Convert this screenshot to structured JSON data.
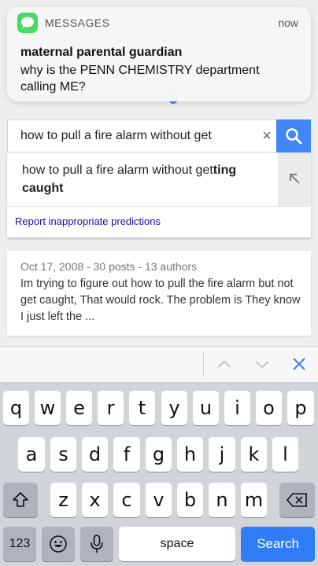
{
  "notification": {
    "app": "MESSAGES",
    "time": "now",
    "title": "maternal parental guardian",
    "body": "why is the PENN CHEMISTRY department calling ME?"
  },
  "search": {
    "query": "how to pull a fire alarm without get",
    "clear_label": "×"
  },
  "suggestions": [
    {
      "prefix": "how to pull a fire alarm without get",
      "completion": "ting caught"
    }
  ],
  "report_link": "Report inappropriate predictions",
  "result": {
    "meta": "Oct 17, 2008 - 30 posts - 13 authors",
    "snippet": "Im trying to figure out how to pull the fire alarm but not get caught, That would rock. The problem is They know I just left the ..."
  },
  "keyboard": {
    "row1": [
      "q",
      "w",
      "e",
      "r",
      "t",
      "y",
      "u",
      "i",
      "o",
      "p"
    ],
    "row2": [
      "a",
      "s",
      "d",
      "f",
      "g",
      "h",
      "j",
      "k",
      "l"
    ],
    "row3": [
      "z",
      "x",
      "c",
      "v",
      "b",
      "n",
      "m"
    ],
    "numbers_label": "123",
    "space_label": "space",
    "search_label": "Search"
  },
  "icons": {
    "app": "messages-bubble-icon",
    "search": "magnifier-icon",
    "fill": "arrow-up-left-icon",
    "shift": "shift-arrow-icon",
    "delete": "backspace-icon",
    "emoji": "smiley-icon",
    "dictation": "microphone-icon",
    "prev": "chevron-up-icon",
    "next": "chevron-down-icon",
    "done": "close-icon"
  },
  "colors": {
    "accent": "#4285f4",
    "keyboard_blue": "#2f7cf6",
    "messages_green": "#4cd964",
    "link": "#1a0dab"
  }
}
